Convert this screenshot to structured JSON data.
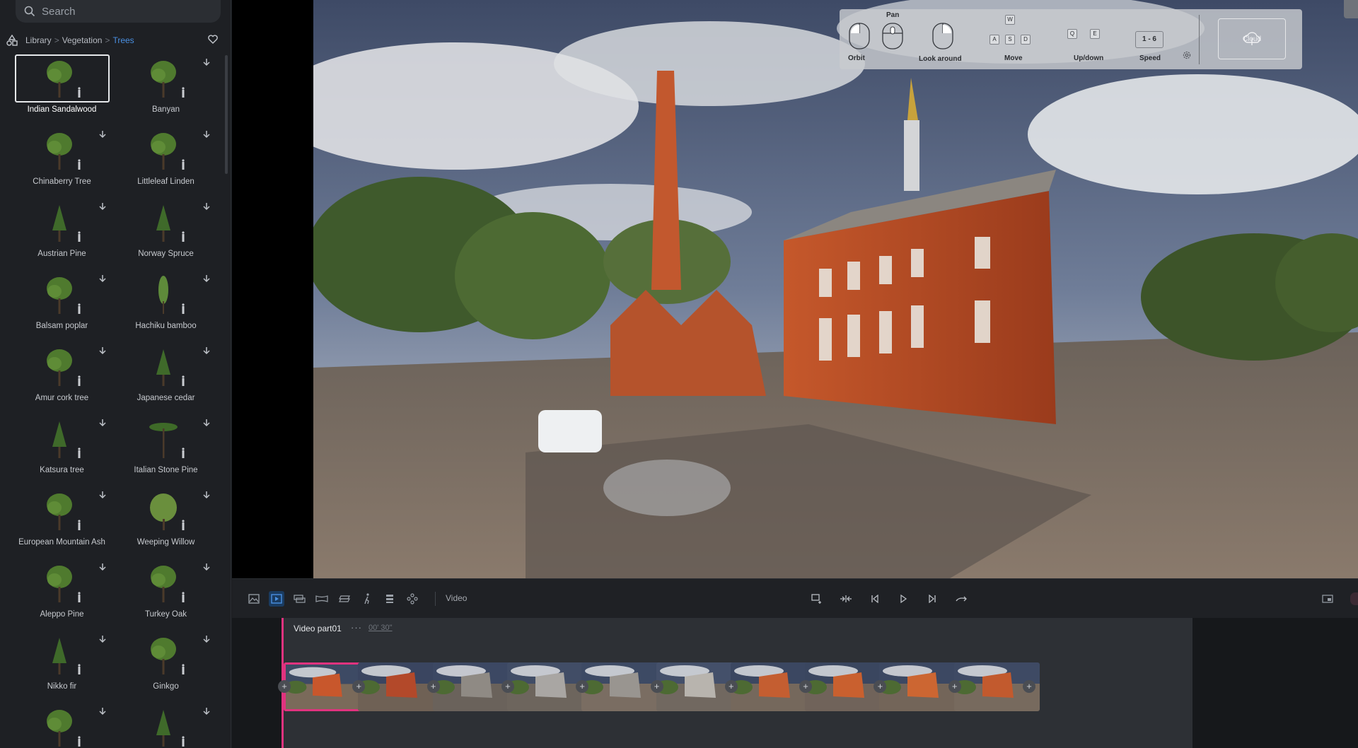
{
  "search": {
    "placeholder": "Search",
    "value": ""
  },
  "breadcrumb": {
    "root": "Library",
    "level1": "Vegetation",
    "current": "Trees"
  },
  "library": {
    "items": [
      {
        "label": "Indian Sandalwood",
        "selected": true
      },
      {
        "label": "Banyan"
      },
      {
        "label": "Chinaberry Tree"
      },
      {
        "label": "Littleleaf Linden"
      },
      {
        "label": "Austrian Pine"
      },
      {
        "label": "Norway Spruce"
      },
      {
        "label": "Balsam poplar"
      },
      {
        "label": "Hachiku bamboo"
      },
      {
        "label": "Amur cork tree"
      },
      {
        "label": "Japanese cedar"
      },
      {
        "label": "Katsura tree"
      },
      {
        "label": "Italian Stone Pine"
      },
      {
        "label": "European Mountain Ash"
      },
      {
        "label": "Weeping Willow"
      },
      {
        "label": "Aleppo Pine"
      },
      {
        "label": "Turkey Oak"
      },
      {
        "label": "Nikko fir"
      },
      {
        "label": "Ginkgo"
      },
      {
        "label": ""
      },
      {
        "label": ""
      }
    ]
  },
  "nav_hud": {
    "pan": "Pan",
    "orbit": "Orbit",
    "look_around": "Look around",
    "move": "Move",
    "updown": "Up/down",
    "speed": "Speed",
    "speed_value": "1 - 6",
    "cloud": "Cloud",
    "keys": {
      "w": "W",
      "a": "A",
      "s": "S",
      "d": "D",
      "q": "Q",
      "e": "E"
    }
  },
  "toolbar": {
    "mode_label": "Video"
  },
  "timeline": {
    "clip_title": "Video part01",
    "more": "···",
    "duration": "00' 30\"",
    "frame_count": 10,
    "selected_frame": 0
  },
  "colors": {
    "accent": "#4a90e2",
    "playhead": "#e0337f",
    "active_tool": "#1a3b60"
  }
}
